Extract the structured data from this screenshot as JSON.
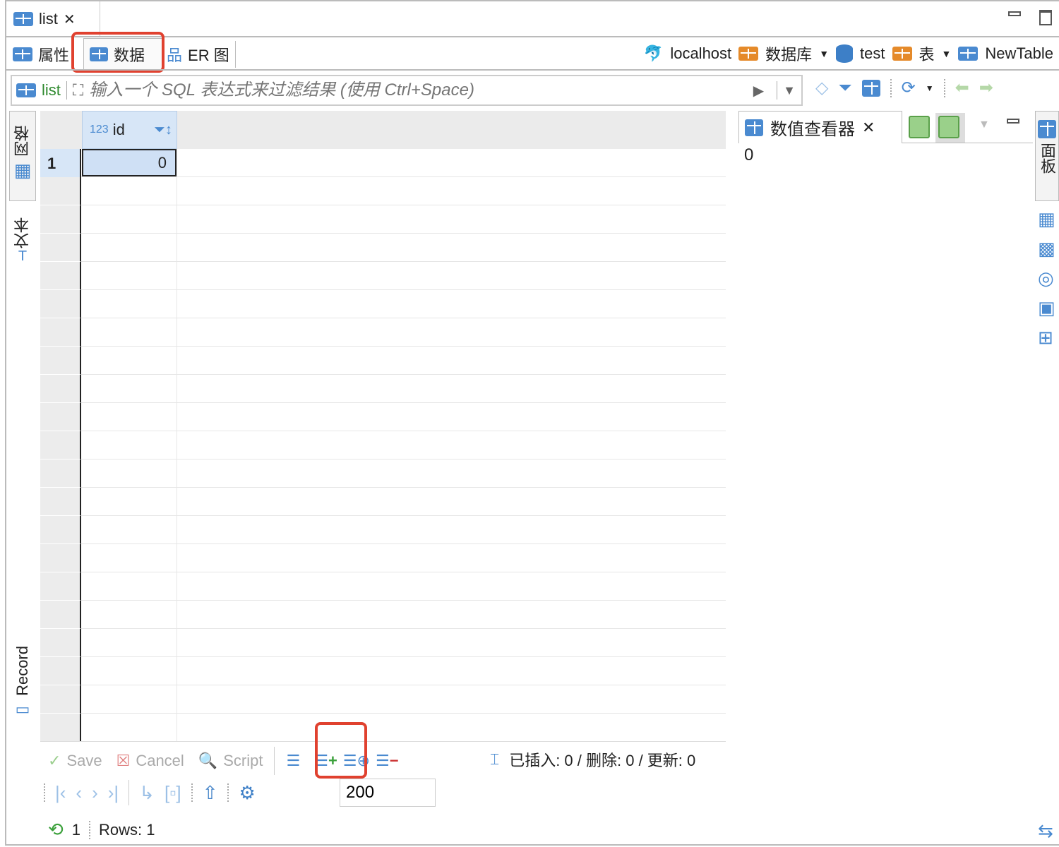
{
  "editor_tab": {
    "label": "list",
    "close": "✕"
  },
  "sub_tabs": [
    {
      "label": "属性"
    },
    {
      "label": "数据",
      "active": true
    },
    {
      "label": "ER 图"
    }
  ],
  "breadcrumb": [
    {
      "label": "localhost"
    },
    {
      "label": "数据库",
      "dropdown": true
    },
    {
      "label": "test"
    },
    {
      "label": "表",
      "dropdown": true
    },
    {
      "label": "NewTable"
    }
  ],
  "filter": {
    "entity": "list",
    "placeholder": "输入一个 SQL 表达式来过滤结果 (使用 Ctrl+Space)"
  },
  "left_tabs": {
    "grid": "网格",
    "text": "文本",
    "record": "Record"
  },
  "grid": {
    "columns": [
      {
        "name": "id",
        "type": "123"
      }
    ],
    "rows": [
      {
        "num": "1",
        "id": "0"
      }
    ]
  },
  "value_viewer": {
    "title": "数值查看器",
    "value": "0"
  },
  "right_panel": {
    "label": "面板"
  },
  "bottom": {
    "save": "Save",
    "cancel": "Cancel",
    "script": "Script",
    "status": "已插入: 0 / 删除: 0 / 更新: 0",
    "fetch_size": "200",
    "refresh_count": "1",
    "rows": "Rows: 1"
  },
  "colors": {
    "accent": "#4a8ad0",
    "highlight": "#e0412f",
    "selected_cell": "#cfe0f5"
  }
}
